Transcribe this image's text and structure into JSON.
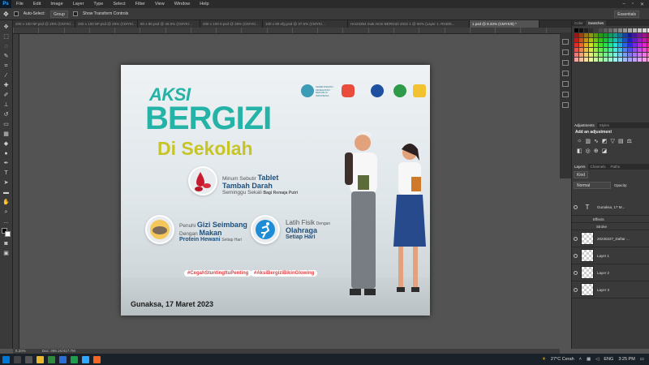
{
  "app": {
    "logo": "Ps"
  },
  "menu": [
    "File",
    "Edit",
    "Image",
    "Layer",
    "Type",
    "Select",
    "Filter",
    "View",
    "Window",
    "Help"
  ],
  "options": {
    "auto_select_label": "Auto-Select:",
    "auto_select_value": "Group",
    "transform_label": "Show Transform Controls",
    "workspace": "Essentials"
  },
  "tabs": [
    "200 x 100 NF.psd @ 25% (CMYK/...",
    "200 x 100 NF.psd @ 25% (CMYK/...",
    "80 x 80.psd @ 40.5% (CMYK/...",
    "200 x 100 0.psd @ 25% (CMYK/...",
    "100 x 80 efg.psd @ 37.6% (CMYK/...",
    "Hm23354 mak AKSI BERGIZI 2022 1 @ 50% (Layer 1, RGB/8...",
    "1.psd @ 8.33% (CMYK/8) *"
  ],
  "canvas": {
    "aksi": "AKSI",
    "bergizi": "BERGIZI",
    "sekolah": "Di Sekolah",
    "m1_small": "Minum Sebutir",
    "m1_bold1": "Tablet",
    "m1_bold2": "Tambah Darah",
    "m1_line3": "Seminggu Sekali",
    "m1_line3b": "Bagi Remaja Putri",
    "m2_small": "Penuhi",
    "m2_b1": "Gizi Seimbang",
    "m2_small2": "Dengan",
    "m2_b2": "Makan",
    "m2_b3": "Protein Hewani",
    "m2_tail": "Setiap Hari",
    "m3_small": "Latih Fisik",
    "m3_small2": "Dengan",
    "m3_b1": "Olahraga",
    "m3_b2": "Setiap Hari",
    "tag1": "#CegahStuntingItuPenting",
    "tag2": "#AksiBergiziBikinGlowing",
    "date": "Gunaksa, 17 Maret 2023",
    "logo_text": "KEMENTERIAN KESEHATAN REPUBLIK INDONESIA"
  },
  "panels": {
    "color_tabs": [
      "Color",
      "Swatches"
    ],
    "adjust_tabs": [
      "Adjustments",
      "Styles"
    ],
    "adjust_title": "Add an adjustment",
    "layer_tabs": [
      "Layers",
      "Channels",
      "Paths"
    ],
    "kind": "Kind",
    "blend": "Normal",
    "opacity_label": "Opacity:",
    "layers": [
      "Gunaksa, 17 M...",
      "Effects",
      "Stroke",
      "20230227_Daftar ...",
      "Layer 1",
      "Layer 2",
      "Layer 3"
    ]
  },
  "status": {
    "zoom": "8.33%",
    "doc": "Doc: 399.1K/417.7M"
  },
  "taskbar": {
    "weather": "27°C Cerah",
    "lang": "ENG",
    "time": "3:25 PM"
  }
}
